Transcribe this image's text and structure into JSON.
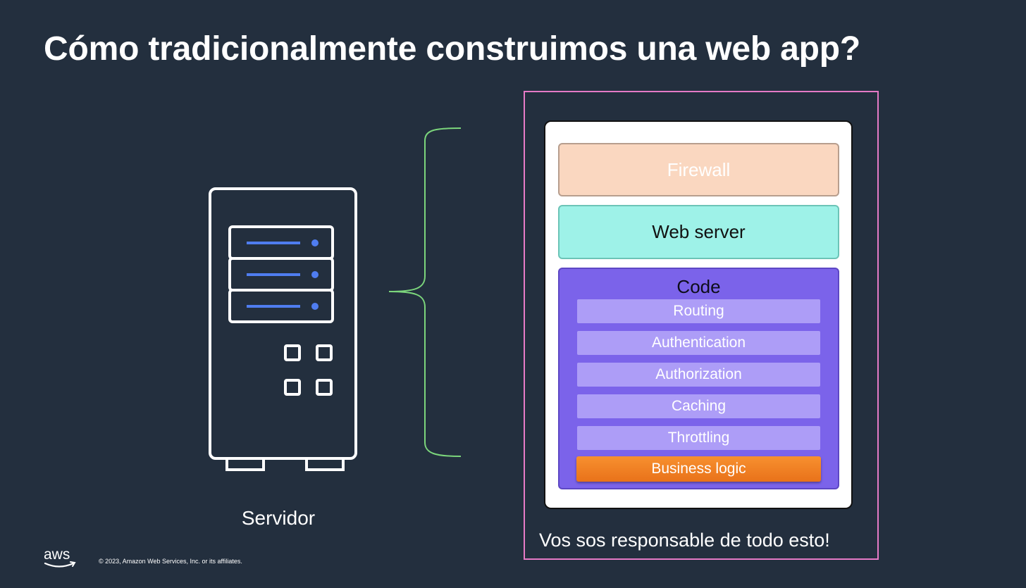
{
  "slide": {
    "title": "Cómo tradicionalmente construimos una web app?",
    "server_label": "Servidor",
    "responsibility_caption": "Vos sos responsable de todo esto!",
    "copyright": "© 2023, Amazon Web Services, Inc. or its affiliates.",
    "logo_text": "aws"
  },
  "stack": {
    "firewall": "Firewall",
    "web_server": "Web server",
    "code": {
      "label": "Code",
      "items": [
        "Routing",
        "Authentication",
        "Authorization",
        "Caching",
        "Throttling",
        "Business logic"
      ]
    }
  },
  "colors": {
    "background": "#232f3e",
    "firewall": "#fad7c0",
    "web_server": "#9ef2e8",
    "code": "#7b63ea",
    "code_item": "#ad9df7",
    "business_logic": "#f7902f",
    "brace": "#7cd67c",
    "frame": "#e57ac6",
    "server_accent": "#4f7df0"
  }
}
